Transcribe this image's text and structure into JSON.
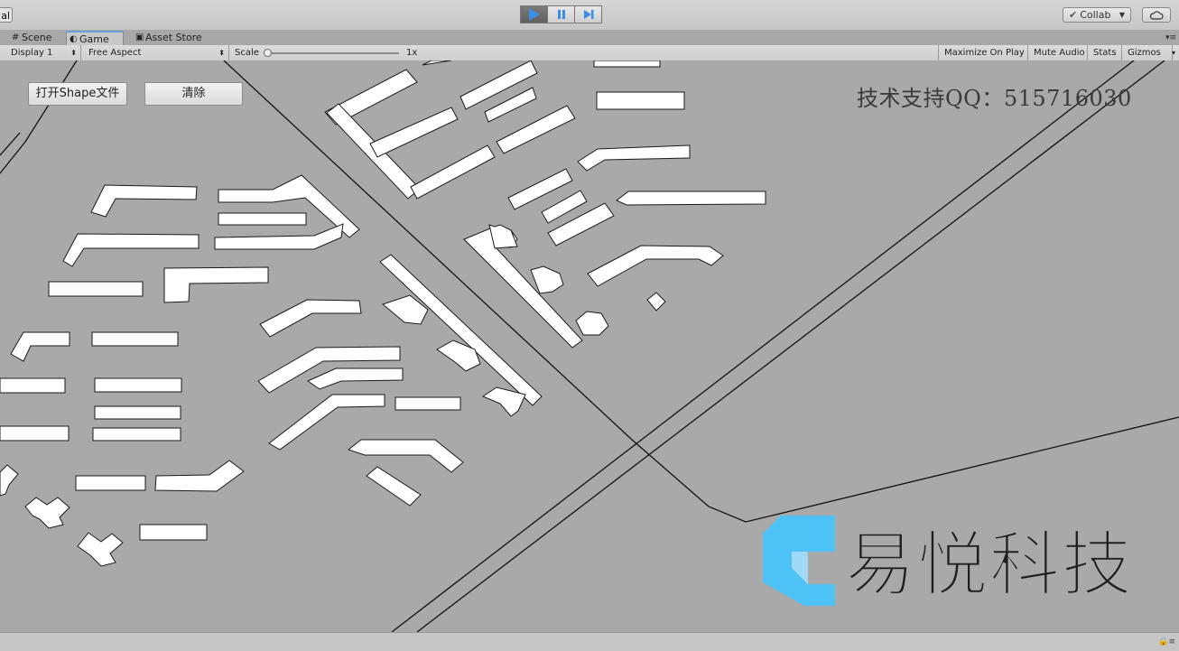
{
  "toolbar": {
    "left_stub": "al",
    "collab_label": "Collab",
    "play_icon": "play-icon",
    "pause_icon": "pause-icon",
    "step_icon": "step-icon",
    "cloud_icon": "cloud-icon"
  },
  "tabs": [
    {
      "label": "Scene",
      "icon": "grid-icon"
    },
    {
      "label": "Game",
      "icon": "pacman-icon"
    },
    {
      "label": "Asset Store",
      "icon": "store-icon"
    }
  ],
  "gamebar": {
    "display": "Display 1",
    "aspect": "Free Aspect",
    "scale_label": "Scale",
    "scale_value": "1x",
    "maximize": "Maximize On Play",
    "mute": "Mute Audio",
    "stats": "Stats",
    "gizmos": "Gizmos"
  },
  "game": {
    "open_button": "打开Shape文件",
    "clear_button": "清除",
    "support_text": "技术支持QQ：515716030",
    "brand_text": "易悦科技"
  },
  "colors": {
    "accent": "#4fc3f7",
    "play_blue": "#3a8ee6",
    "game_bg": "#a9a9a9"
  }
}
